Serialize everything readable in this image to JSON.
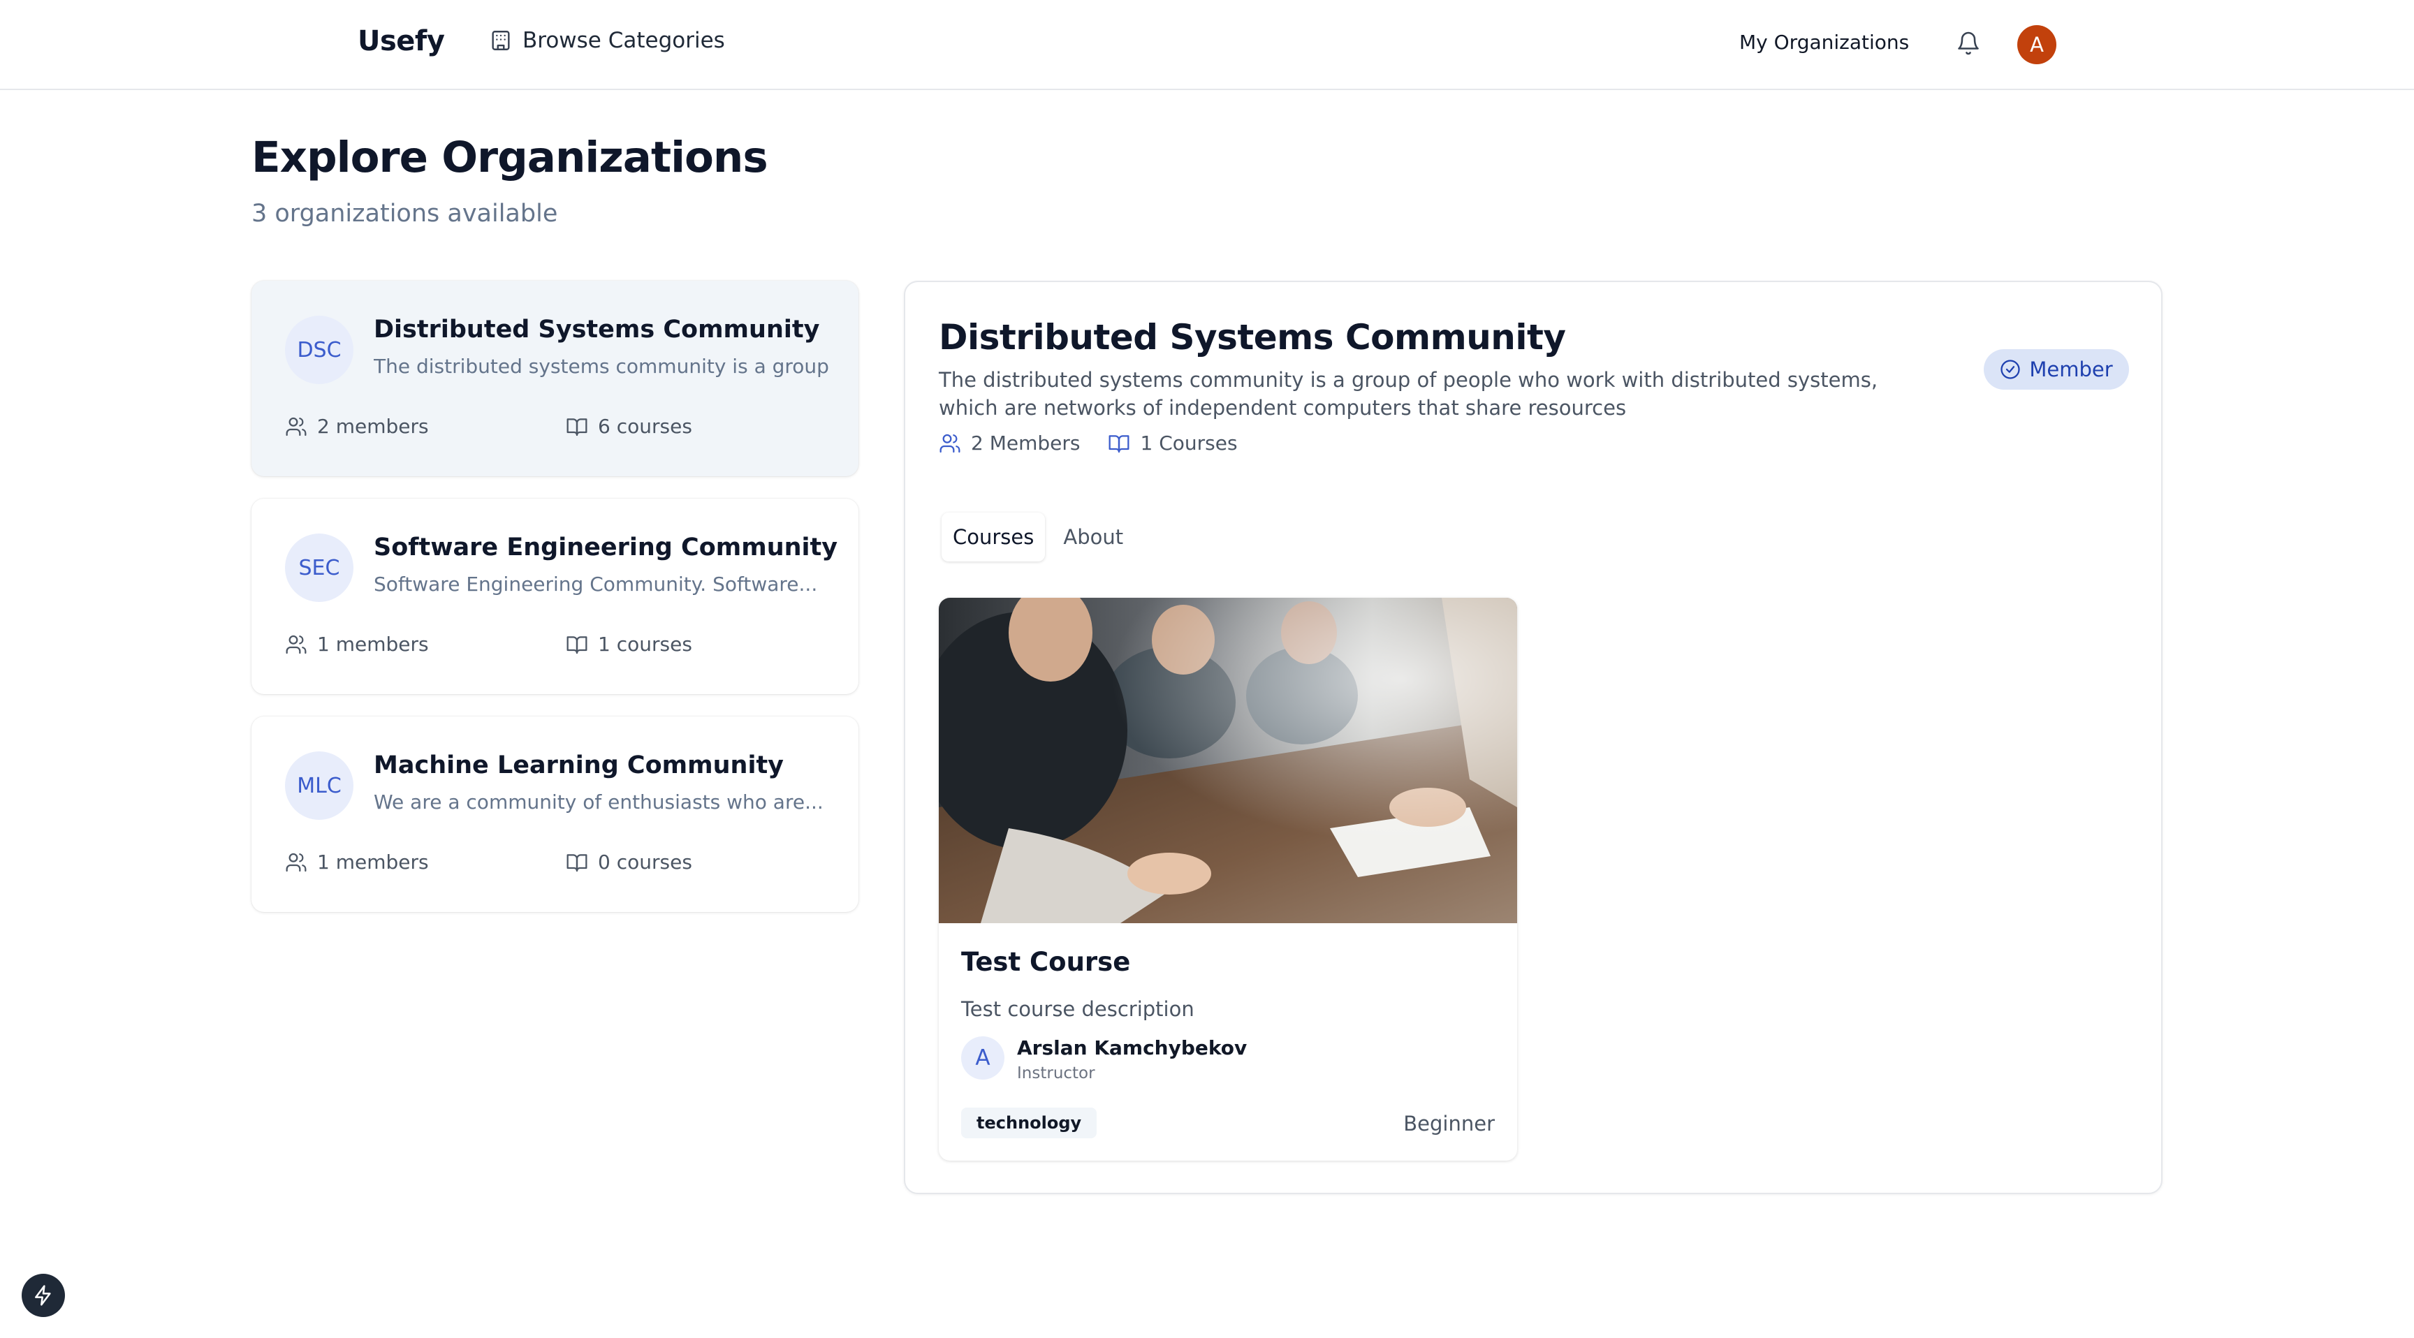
{
  "header": {
    "brand": "Usefy",
    "browse_label": "Browse Categories",
    "my_orgs_label": "My Organizations",
    "avatar_letter": "A"
  },
  "page": {
    "title": "Explore Organizations",
    "subtitle": "3 organizations available"
  },
  "organizations": [
    {
      "abbr": "DSC",
      "name": "Distributed Systems Community",
      "description": "The distributed systems community is a group o...",
      "members": "2 members",
      "courses": "6 courses"
    },
    {
      "abbr": "SEC",
      "name": "Software Engineering Community",
      "description": "Software Engineering Community. Software...",
      "members": "1 members",
      "courses": "1 courses"
    },
    {
      "abbr": "MLC",
      "name": "Machine Learning Community",
      "description": "We are a community of enthusiasts who are...",
      "members": "1 members",
      "courses": "0 courses"
    }
  ],
  "detail": {
    "title": "Distributed Systems Community",
    "description": "The distributed systems community is a group of people who work with distributed systems, which are networks of independent computers that share resources",
    "members": "2 Members",
    "courses": "1 Courses",
    "member_badge": "Member",
    "tabs": [
      "Courses",
      "About"
    ],
    "course": {
      "title": "Test Course",
      "description": "Test course description",
      "instructor_initial": "A",
      "instructor_name": "Arslan Kamchybekov",
      "instructor_role": "Instructor",
      "tag": "technology",
      "level": "Beginner"
    }
  },
  "colors": {
    "accent": "#3b5ccc",
    "avatar_bg": "#c2410c",
    "badge_bg": "#dbe4f7",
    "muted_text": "#64748b"
  }
}
